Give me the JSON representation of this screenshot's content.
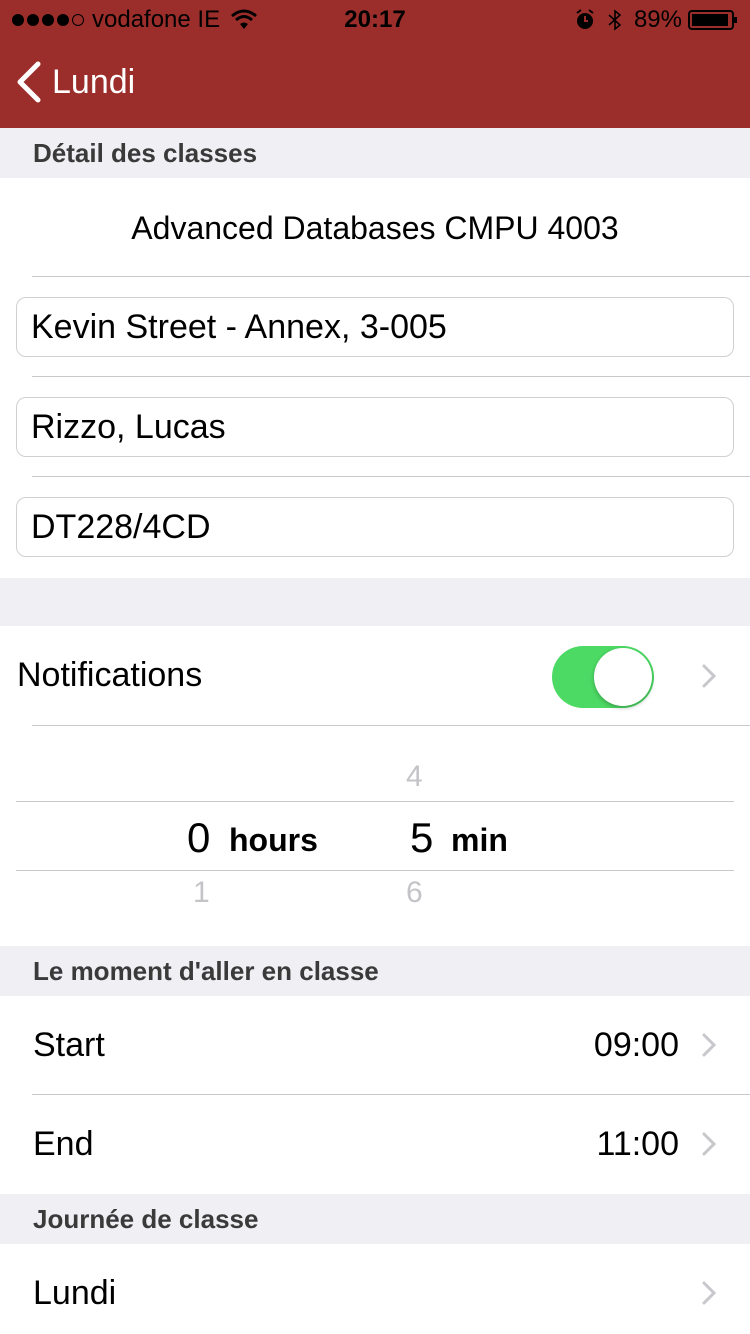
{
  "status_bar": {
    "carrier": "vodafone IE",
    "time": "20:17",
    "battery": "89%"
  },
  "nav": {
    "back_label": "Lundi"
  },
  "sections": {
    "class_details": "Détail des classes",
    "class_time": "Le moment d'aller en classe",
    "class_day": "Journée de classe"
  },
  "class": {
    "title": "Advanced Databases CMPU 4003",
    "location": "Kevin Street - Annex, 3-005",
    "lecturer": "Rizzo, Lucas",
    "group": "DT228/4CD"
  },
  "notifications": {
    "label": "Notifications",
    "enabled": true
  },
  "picker": {
    "hours_above": "",
    "hours_value": "0",
    "hours_unit": "hours",
    "hours_below": "1",
    "min_above": "4",
    "min_value": "5",
    "min_unit": "min",
    "min_below": "6"
  },
  "times": {
    "start_label": "Start",
    "start_value": "09:00",
    "end_label": "End",
    "end_value": "11:00"
  },
  "day": {
    "value": "Lundi"
  },
  "colors": {
    "nav_bar": "#9b2e2a",
    "toggle_on": "#4cd964",
    "background": "#efeff4"
  }
}
